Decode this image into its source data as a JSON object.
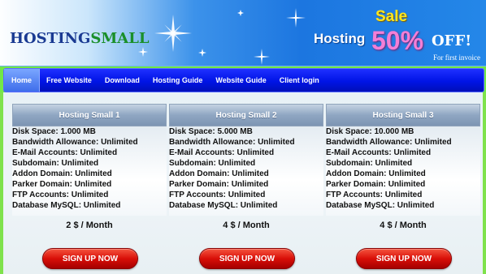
{
  "site": {
    "logo_part1": "HOSTING",
    "logo_part2": "SMALL"
  },
  "promo": {
    "sale": "Sale",
    "hosting": "Hosting",
    "percent": "50%",
    "off": "OFF!",
    "note": "For first invoice"
  },
  "nav": {
    "items": [
      {
        "label": "Home",
        "active": true
      },
      {
        "label": "Free Website"
      },
      {
        "label": "Download"
      },
      {
        "label": "Hosting Guide"
      },
      {
        "label": "Website Guide"
      },
      {
        "label": "Client login"
      }
    ]
  },
  "plans": [
    {
      "title": "Hosting Small 1",
      "features": [
        "Disk Space: 1.000 MB",
        "Bandwidth Allowance: Unlimited",
        "E-Mail Accounts: Unlimited",
        "Subdomain: Unlimited",
        "Addon Domain: Unlimited",
        "Parker Domain: Unlimited",
        "FTP Accounts: Unlimited",
        "Database MySQL: Unlimited"
      ],
      "price": "2 $ / Month",
      "button": "SIGN UP NOW"
    },
    {
      "title": "Hosting Small 2",
      "features": [
        "Disk Space: 5.000 MB",
        "Bandwidth Allowance: Unlimited",
        "E-Mail Accounts: Unlimited",
        "Subdomain: Unlimited",
        "Addon Domain: Unlimited",
        "Parker Domain: Unlimited",
        "FTP Accounts: Unlimited",
        "Database MySQL: Unlimited"
      ],
      "price": "4 $ / Month",
      "button": "SIGN UP NOW"
    },
    {
      "title": "Hosting Small 3",
      "features": [
        "Disk Space: 10.000 MB",
        "Bandwidth Allowance: Unlimited",
        "E-Mail Accounts: Unlimited",
        "Subdomain: Unlimited",
        "Addon Domain: Unlimited",
        "Parker Domain: Unlimited",
        "FTP Accounts: Unlimited",
        "Database MySQL: Unlimited"
      ],
      "price": "4 $ / Month",
      "button": "SIGN UP NOW"
    }
  ],
  "colors": {
    "nav_bg": "#0014e6",
    "signup_red": "#d90f08",
    "page_green": "#5fe236"
  }
}
